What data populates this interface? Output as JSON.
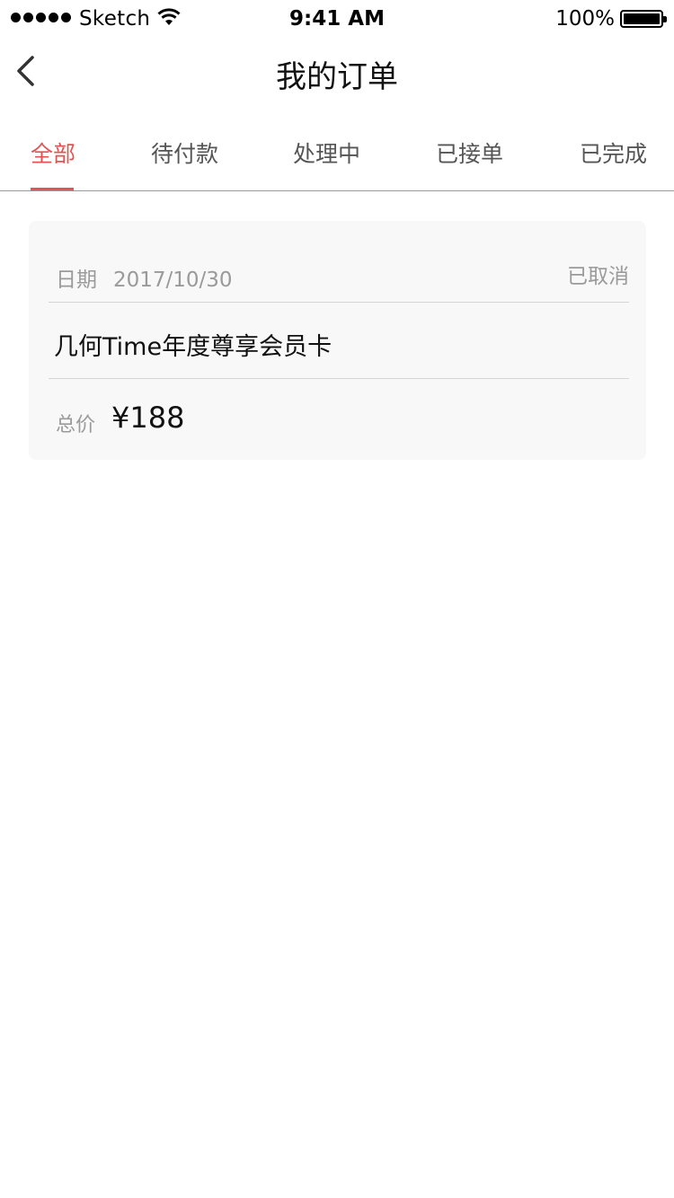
{
  "status_bar": {
    "carrier": "Sketch",
    "time": "9:41 AM",
    "battery": "100%",
    "battery_level": 1.0
  },
  "nav": {
    "title": "我的订单",
    "back_icon": "chevron-left-icon"
  },
  "tabs": [
    {
      "label": "全部",
      "active": true
    },
    {
      "label": "待付款",
      "active": false
    },
    {
      "label": "处理中",
      "active": false
    },
    {
      "label": "已接单",
      "active": false
    },
    {
      "label": "已完成",
      "active": false
    }
  ],
  "orders": [
    {
      "date_label": "日期",
      "date": "2017/10/30",
      "status": "已取消",
      "product": "几何Time年度尊享会员卡",
      "price_label": "总价",
      "price": "¥188"
    }
  ],
  "colors": {
    "accent": "#e05454",
    "muted_text": "#9a9a9a",
    "card_bg": "#f8f8f8"
  }
}
